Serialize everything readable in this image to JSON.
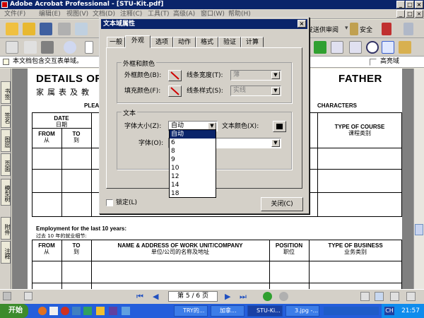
{
  "window": {
    "title": "Adobe Acrobat Professional - [STU-Kit.pdf]"
  },
  "menu": [
    "文件(F)",
    "编辑(E)",
    "视图(V)",
    "文档(D)",
    "注释(C)",
    "工具(T)",
    "高级(A)",
    "窗口(W)",
    "帮助(H)"
  ],
  "toolbar": {
    "send_review": "发送供审阅",
    "security": "安全"
  },
  "message_bar": {
    "text": "本文档包含交互表单域。",
    "highlight_label": "高亮域"
  },
  "side_tabs": [
    "书签",
    "签名",
    "图层",
    "页面",
    "模型树",
    "附件",
    "注释"
  ],
  "document": {
    "title_left": "DETAILS OF",
    "title_right": "FATHER",
    "subtitle": "家属表及教",
    "partial_left": "PLEA",
    "partial_right": "CHARACTERS",
    "table1": {
      "date": "DATE",
      "date_cn": "日期",
      "from": "FROM",
      "from_cn": "从",
      "to": "TO",
      "to_cn": "到",
      "type_course": "TYPE OF COURSE",
      "type_course_cn": "课程类别"
    },
    "employment_title": "Employment for the last 10 years:",
    "employment_title_cn": "过去 10 年的就业细节:",
    "table2": {
      "from": "FROM",
      "from_cn": "从",
      "to": "TO",
      "to_cn": "到",
      "name_addr": "NAME & ADDRESS OF WORK UNIT/COMPANY",
      "name_addr_cn": "单位/公司的名称及地址",
      "position": "POSITION",
      "position_cn": "职位",
      "type_business": "TYPE OF BUSINESS",
      "type_business_cn": "业务类别"
    }
  },
  "dialog": {
    "title": "文本域属性",
    "tabs": [
      "一般",
      "外观",
      "选项",
      "动作",
      "格式",
      "验证",
      "计算"
    ],
    "active_tab": "外观",
    "border_group": "外框和颜色",
    "border_color_label": "外框颜色(B):",
    "fill_color_label": "填充颜色(F):",
    "line_width_label": "线条宽度(T):",
    "line_width_value": "薄",
    "line_style_label": "线条样式(S):",
    "line_style_value": "实线",
    "text_group": "文本",
    "font_size_label": "字体大小(Z):",
    "font_size_value": "自动",
    "text_color_label": "文本颜色(X):",
    "font_label": "字体(O):",
    "font_size_options": [
      "自动",
      "6",
      "8",
      "9",
      "10",
      "12",
      "14",
      "18"
    ],
    "locked_label": "锁定(L)",
    "close_button": "关闭(C)"
  },
  "status": {
    "page_indicator": "第 5 / 6 页"
  },
  "taskbar": {
    "start": "开始",
    "tasks": [
      "TRY的...",
      "加拿...",
      "STU-Ki...",
      "3.jpg -..."
    ],
    "ime": "CH",
    "clock": "21:57"
  },
  "colors": {
    "titlebar": "#0a246a",
    "taskbar": "#245edb",
    "selection": "#0a246a"
  }
}
